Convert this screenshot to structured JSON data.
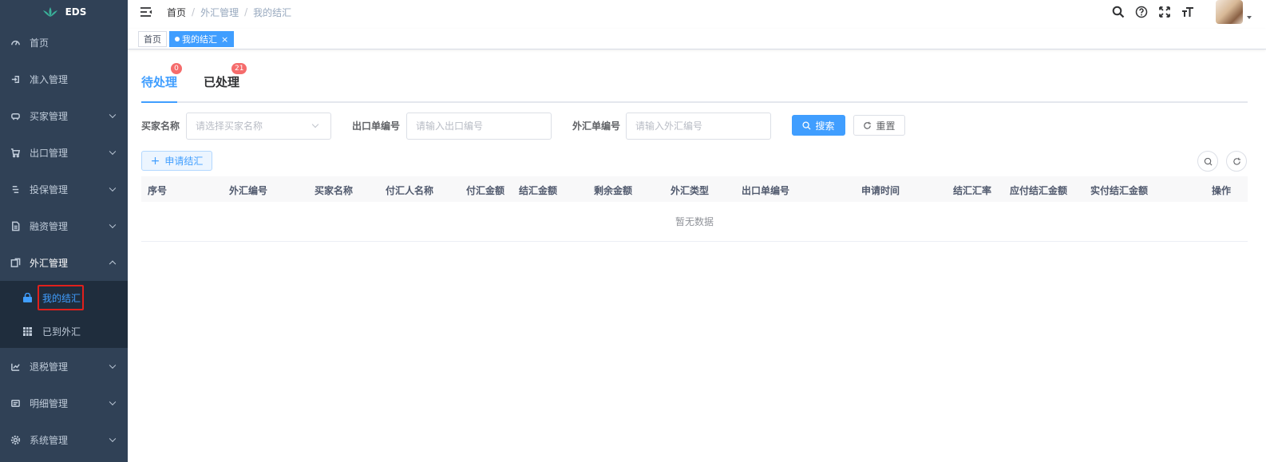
{
  "app": {
    "logo_text": "EDS"
  },
  "sidebar": {
    "items": [
      {
        "label": "首页",
        "icon": "dashboard-icon",
        "has_children": false
      },
      {
        "label": "准入管理",
        "icon": "login-icon",
        "has_children": false
      },
      {
        "label": "买家管理",
        "icon": "people-icon",
        "has_children": true
      },
      {
        "label": "出口管理",
        "icon": "shopping-cart-icon",
        "has_children": true
      },
      {
        "label": "投保管理",
        "icon": "list-icon",
        "has_children": true
      },
      {
        "label": "融资管理",
        "icon": "document-icon",
        "has_children": true
      },
      {
        "label": "外汇管理",
        "icon": "exchange-icon",
        "has_children": true,
        "expanded": true
      },
      {
        "label": "退税管理",
        "icon": "refund-icon",
        "has_children": true
      },
      {
        "label": "明细管理",
        "icon": "detail-icon",
        "has_children": true
      },
      {
        "label": "系统管理",
        "icon": "gear-icon",
        "has_children": true
      }
    ],
    "submenu": [
      {
        "label": "我的结汇",
        "icon": "lock-icon",
        "active": true
      },
      {
        "label": "已到外汇",
        "icon": "grid-icon",
        "active": false
      }
    ]
  },
  "breadcrumb": [
    "首页",
    "外汇管理",
    "我的结汇"
  ],
  "tags": [
    {
      "label": "首页",
      "active": false
    },
    {
      "label": "我的结汇",
      "active": true,
      "close": "×"
    }
  ],
  "tabs": [
    {
      "label": "待处理",
      "badge": "0",
      "active": true
    },
    {
      "label": "已处理",
      "badge": "21",
      "active": false
    }
  ],
  "filters": {
    "buyer_label": "买家名称",
    "buyer_placeholder": "请选择买家名称",
    "export_label": "出口单编号",
    "export_placeholder": "请输入出口编号",
    "fx_label": "外汇单编号",
    "fx_placeholder": "请输入外汇编号",
    "search_btn": "搜索",
    "reset_btn": "重置"
  },
  "toolbar": {
    "apply_btn": "申请结汇"
  },
  "table": {
    "columns": [
      "序号",
      "外汇编号",
      "买家名称",
      "付汇人名称",
      "付汇金额",
      "结汇金额",
      "剩余金额",
      "外汇类型",
      "出口单编号",
      "申请时间",
      "结汇汇率",
      "应付结汇金额",
      "实付结汇金额",
      "操作"
    ],
    "empty_text": "暂无数据"
  },
  "colors": {
    "sidebar_bg": "#304156",
    "submenu_bg": "#1f2d3d",
    "primary": "#409eff",
    "badge": "#f56c6c"
  }
}
